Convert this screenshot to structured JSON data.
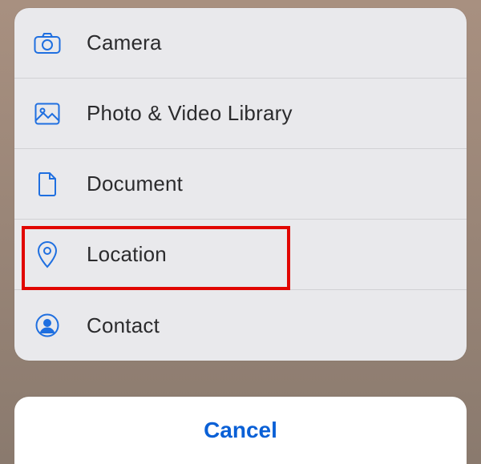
{
  "menu": {
    "items": [
      {
        "label": "Camera"
      },
      {
        "label": "Photo & Video Library"
      },
      {
        "label": "Document"
      },
      {
        "label": "Location"
      },
      {
        "label": "Contact"
      }
    ]
  },
  "cancel": {
    "label": "Cancel"
  },
  "highlight_index": 3,
  "colors": {
    "accent": "#1f6fe0",
    "highlight": "#e10600"
  }
}
